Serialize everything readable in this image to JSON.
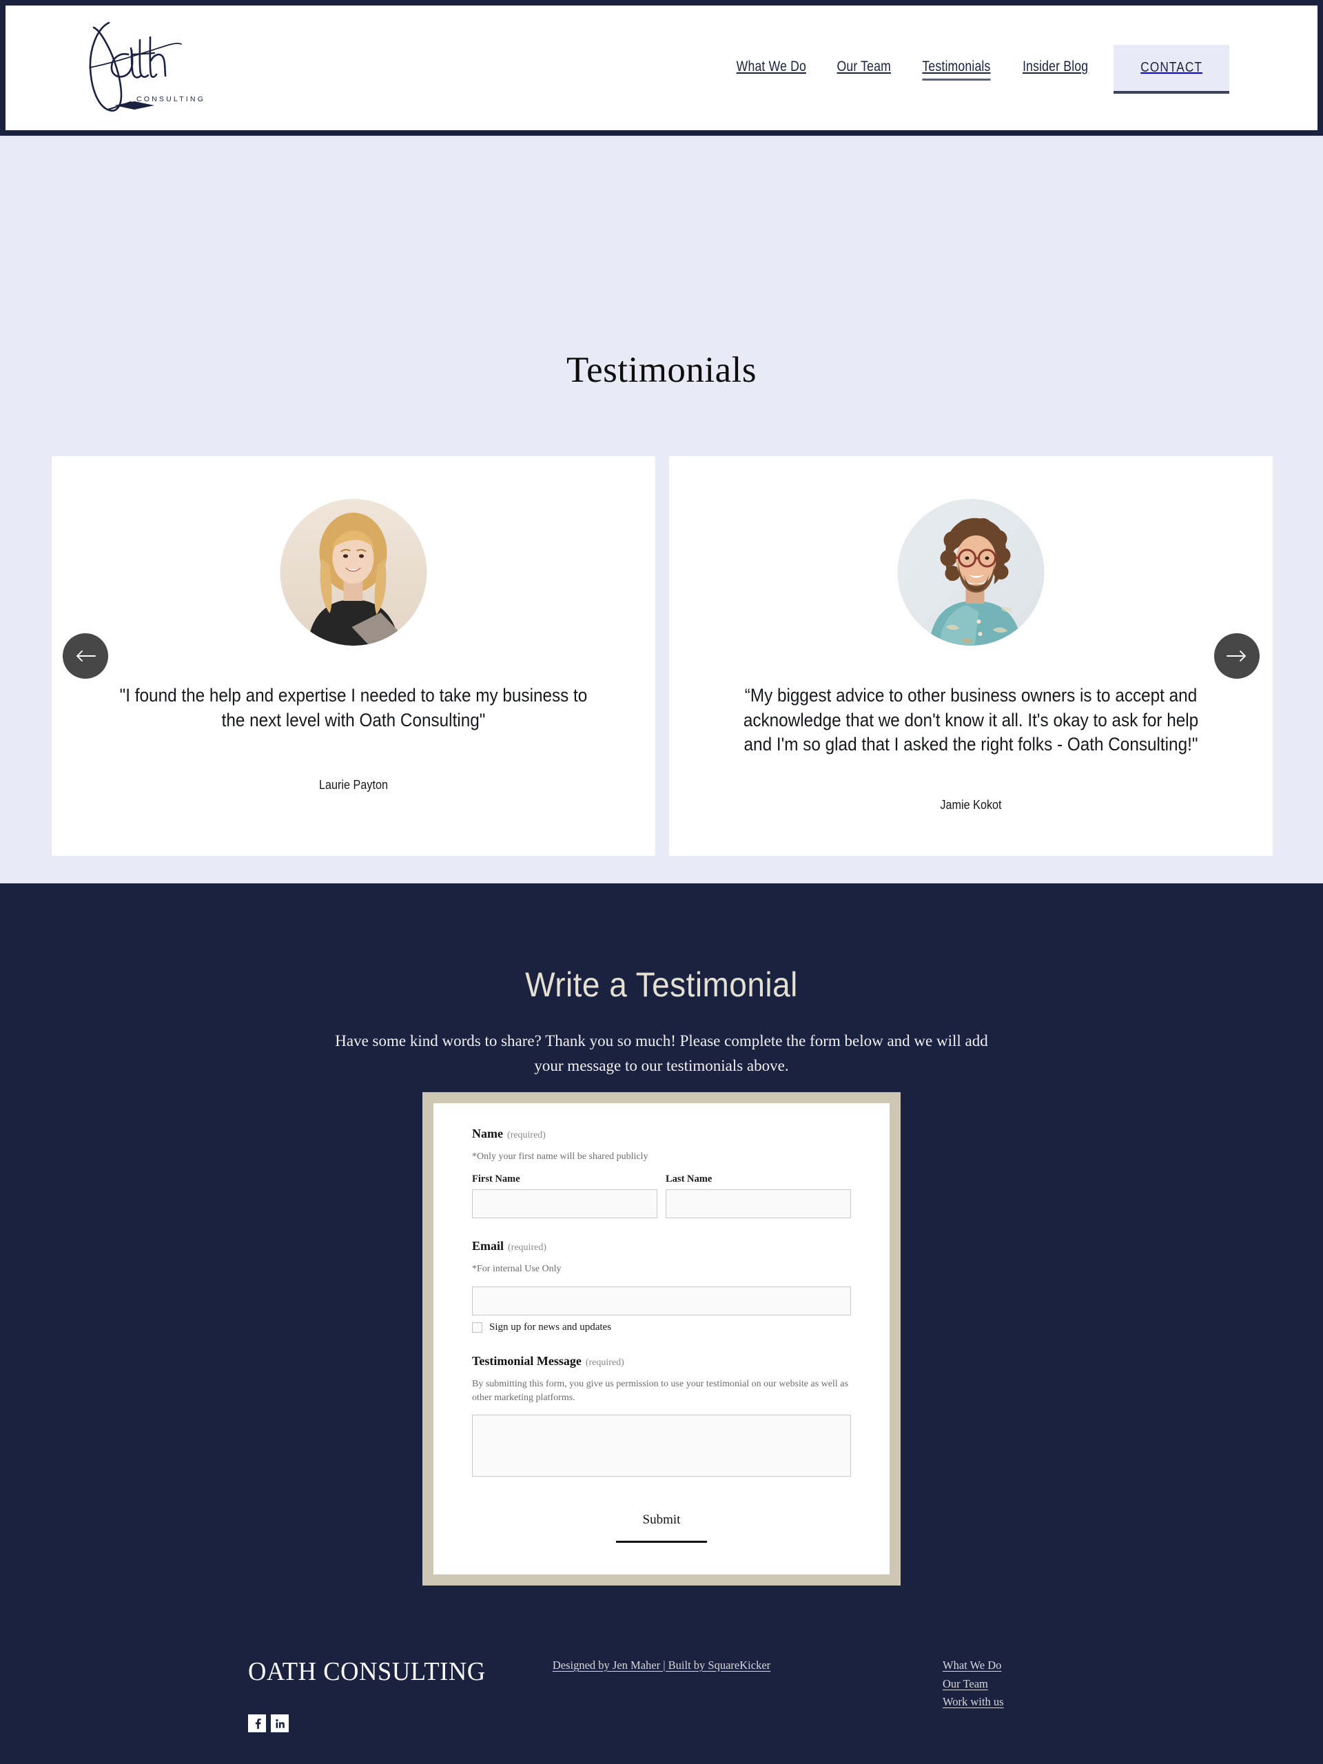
{
  "header": {
    "logo": {
      "wordmark": "Oath",
      "subtitle": "CONSULTING"
    },
    "nav": [
      {
        "label": "What We Do",
        "active": false
      },
      {
        "label": "Our Team",
        "active": false
      },
      {
        "label": "Testimonials",
        "active": true
      },
      {
        "label": "Insider Blog",
        "active": false
      }
    ],
    "contact_label": "CONTACT"
  },
  "testimonials_section": {
    "title": "Testimonials",
    "prev_label": "Previous testimonial",
    "next_label": "Next testimonial",
    "cards": [
      {
        "quote": "\"I found the help and expertise I needed to take my business to the next level with Oath Consulting\"",
        "author": "Laurie Payton",
        "avatar": "portrait-blonde-woman"
      },
      {
        "quote": "“My biggest advice to other business owners is to accept and acknowledge that we don't know it all. It's okay to ask for help and I'm so glad that I asked the right folks - Oath Consulting!\"",
        "author": "Jamie Kokot",
        "avatar": "portrait-curly-haired-man-glasses"
      }
    ]
  },
  "write_section": {
    "title": "Write a Testimonial",
    "subtitle": "Have some kind words to share? Thank you so much! Please complete the form below and we will add your message to our testimonials above.",
    "form": {
      "name": {
        "label": "Name",
        "required_tag": "(required)",
        "note": "*Only your first name will be shared publicly",
        "first_label": "First Name",
        "first_value": "",
        "last_label": "Last Name",
        "last_value": ""
      },
      "email": {
        "label": "Email",
        "required_tag": "(required)",
        "note": "*For internal Use Only",
        "value": "",
        "checkbox_label": "Sign up for news and updates",
        "checked": false
      },
      "message": {
        "label": "Testimonial Message",
        "required_tag": "(required)",
        "note": "By submitting this form, you give us permission to use your testimonial on our website as well as other marketing platforms.",
        "value": ""
      },
      "submit_label": "Submit"
    }
  },
  "footer": {
    "brand": "OATH CONSULTING",
    "social": [
      {
        "name": "facebook",
        "glyph": "f"
      },
      {
        "name": "linkedin",
        "glyph": "in"
      }
    ],
    "credit": "Designed by Jen Maher | Built by SquareKicker",
    "links": [
      {
        "label": "What We Do"
      },
      {
        "label": "Our Team"
      },
      {
        "label": "Work with us"
      }
    ]
  },
  "colors": {
    "navy": "#1b2240",
    "lavender": "#e9eaf6",
    "cream": "#e4e0d2",
    "frame_beige": "#cdc7b4",
    "arrow_gray": "#474747"
  }
}
